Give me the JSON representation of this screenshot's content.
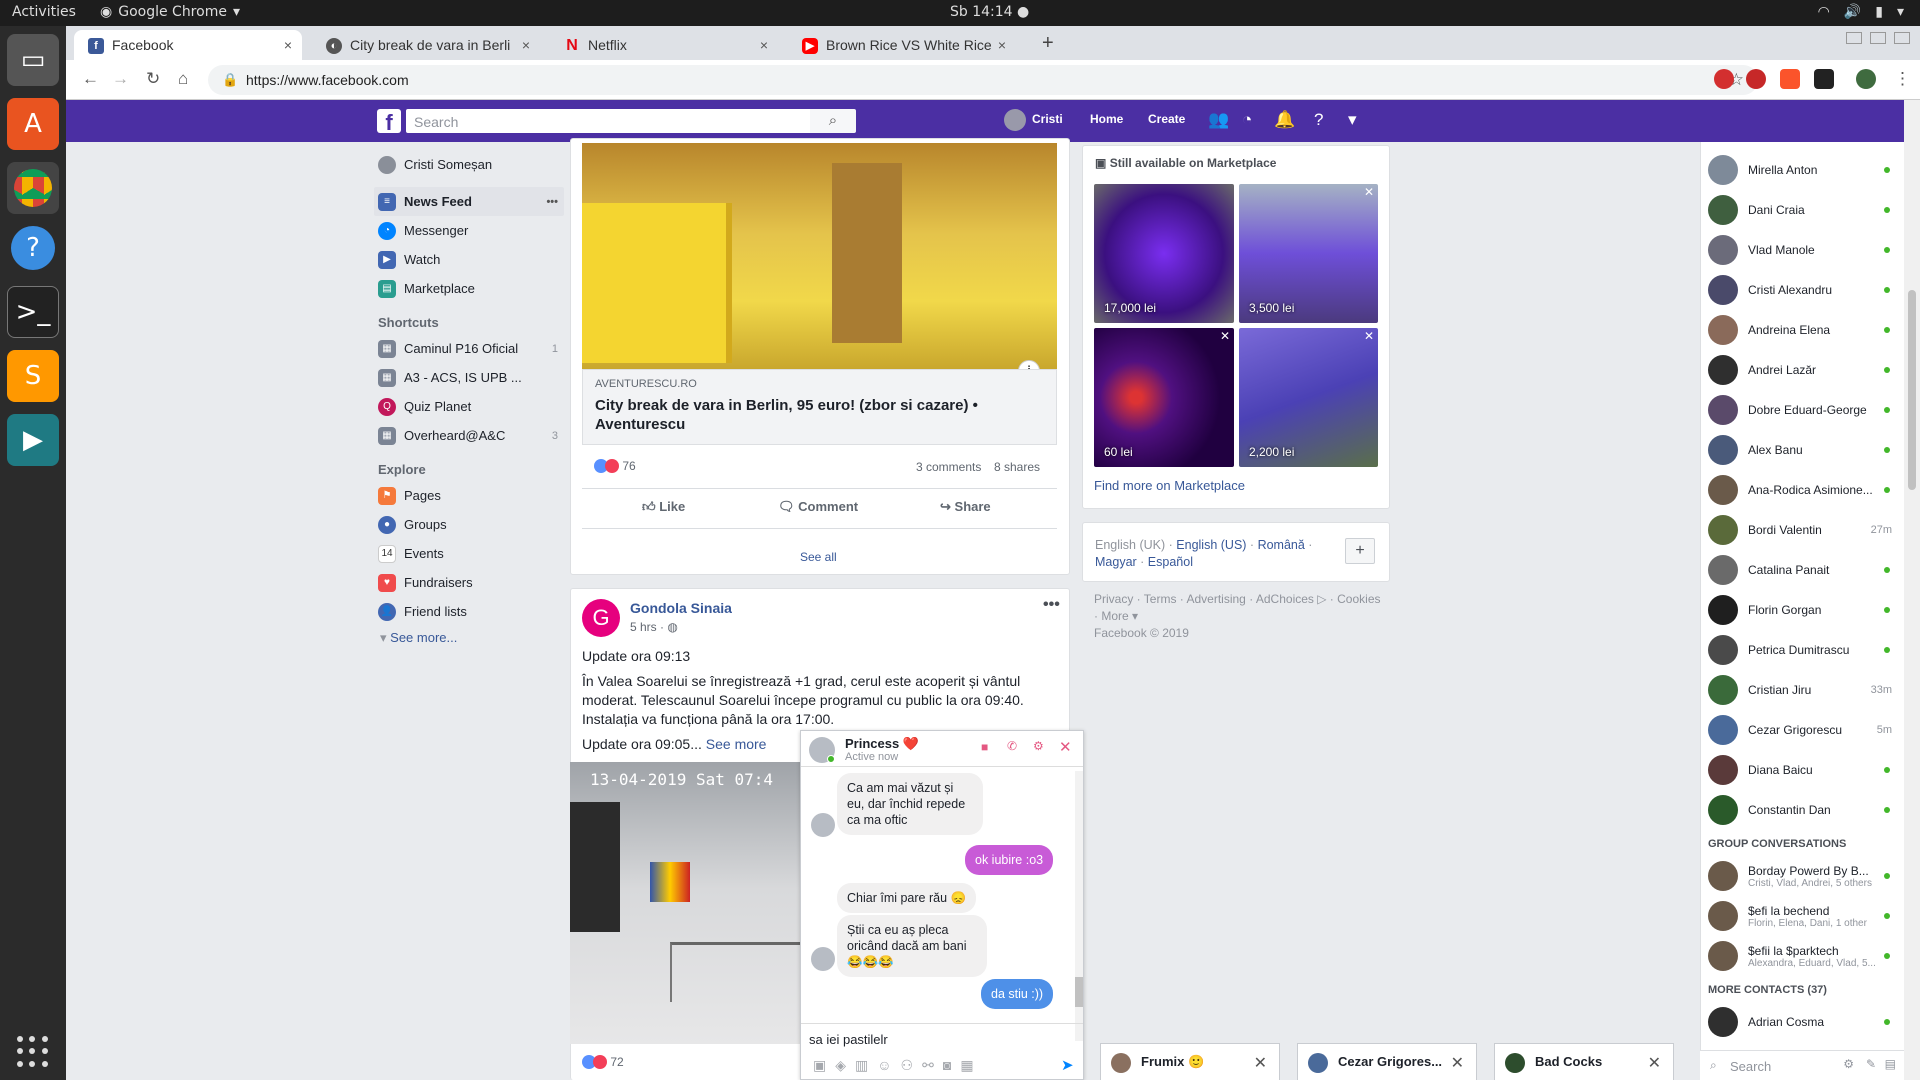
{
  "os": {
    "activities": "Activities",
    "app_name": "Google Chrome",
    "clock": "Sb 14:14 ●"
  },
  "browser": {
    "tabs": [
      {
        "title": "Facebook",
        "icon": "facebook-icon",
        "color": "#3b5998"
      },
      {
        "title": "City break de vara in Berli",
        "icon": "globe-icon",
        "color": "#555555"
      },
      {
        "title": "Netflix",
        "icon": "netflix-icon",
        "color": "#e50914"
      },
      {
        "title": "Brown Rice VS White Rice",
        "icon": "youtube-icon",
        "color": "#ff0000"
      }
    ],
    "url": "https://www.facebook.com"
  },
  "fb": {
    "brand_color": "#4b2fa3",
    "search_placeholder": "Search",
    "user_name": "Cristi",
    "nav_home": "Home",
    "nav_create": "Create"
  },
  "left_nav": {
    "profile": "Cristi Someșan",
    "main": [
      {
        "label": "News Feed",
        "color": "#4267b2"
      },
      {
        "label": "Messenger",
        "color": "#0084ff"
      },
      {
        "label": "Watch",
        "color": "#4267b2"
      },
      {
        "label": "Marketplace",
        "color": "#2a9d8f"
      }
    ],
    "shortcuts_title": "Shortcuts",
    "shortcuts": [
      {
        "label": "Caminul P16 Oficial",
        "count": "1"
      },
      {
        "label": "A3 - ACS, IS UPB ...",
        "count": ""
      },
      {
        "label": "Quiz Planet",
        "count": ""
      },
      {
        "label": "Overheard@A&C",
        "count": "3"
      }
    ],
    "explore_title": "Explore",
    "explore": [
      {
        "label": "Pages",
        "color": "#f5793b"
      },
      {
        "label": "Groups",
        "color": "#4267b2"
      },
      {
        "label": "Events",
        "color": "#e9ebee"
      },
      {
        "label": "Fundraisers",
        "color": "#f04b4c"
      },
      {
        "label": "Friend lists",
        "color": "#4267b2"
      }
    ],
    "see_more": "See more..."
  },
  "post1": {
    "domain": "AVENTURESCU.RO",
    "title": "City break de vara in Berlin, 95 euro! (zbor si cazare) • Aventurescu",
    "reactions": "76",
    "comments": "3 comments",
    "shares": "8 shares",
    "like": "Like",
    "comment": "Comment",
    "share": "Share",
    "see_all": "See all"
  },
  "post2": {
    "page": "Gondola Sinaia",
    "time": "5 hrs · ",
    "line1": "Update ora 09:13",
    "body": "În Valea Soarelui se înregistrează +1 grad, cerul este acoperit și vântul moderat. Telescaunul Soarelui începe programul cu public la ora 09:40. Instalația va funcționa până la ora 17:00.",
    "line2": "Update ora 09:05... ",
    "see_more": "See more",
    "cam_stamp": "13-04-2019 Sat 07:4",
    "reactions": "72"
  },
  "marketplace": {
    "title": "Still available on Marketplace",
    "items": [
      {
        "price": "17,000 lei"
      },
      {
        "price": "3,500 lei"
      },
      {
        "price": "60 lei"
      },
      {
        "price": "2,200 lei"
      }
    ],
    "find_more": "Find more on Marketplace"
  },
  "languages": {
    "current": "English (UK)",
    "others": [
      "English (US)",
      "Română",
      "Magyar",
      "Español"
    ]
  },
  "footer": {
    "links": [
      "Privacy",
      "Terms",
      "Advertising",
      "AdChoices",
      "Cookies",
      "More"
    ],
    "copyright": "Facebook © 2019"
  },
  "contacts": [
    {
      "name": "Mirella Anton",
      "time": ""
    },
    {
      "name": "Dani Craia",
      "time": ""
    },
    {
      "name": "Vlad Manole",
      "time": ""
    },
    {
      "name": "Cristi Alexandru",
      "time": ""
    },
    {
      "name": "Andreina Elena",
      "time": ""
    },
    {
      "name": "Andrei Lazăr",
      "time": ""
    },
    {
      "name": "Dobre Eduard-George",
      "time": ""
    },
    {
      "name": "Alex Banu",
      "time": ""
    },
    {
      "name": "Ana-Rodica Asimione...",
      "time": ""
    },
    {
      "name": "Bordi Valentin",
      "time": "27m"
    },
    {
      "name": "Catalina Panait",
      "time": ""
    },
    {
      "name": "Florin Gorgan",
      "time": ""
    },
    {
      "name": "Petrica Dumitrascu",
      "time": ""
    },
    {
      "name": "Cristian Jiru",
      "time": "33m"
    },
    {
      "name": "Cezar Grigorescu",
      "time": "5m"
    },
    {
      "name": "Diana Baicu",
      "time": ""
    },
    {
      "name": "Constantin Dan",
      "time": ""
    }
  ],
  "group_title": "GROUP CONVERSATIONS",
  "groups": [
    {
      "name": "Borday Powerd By B...",
      "sub": "Cristi, Vlad, Andrei, 5 others"
    },
    {
      "name": "$efi la bechend",
      "sub": "Florin, Elena, Dani, 1 other"
    },
    {
      "name": "$efii la $parktech",
      "sub": "Alexandra, Eduard, Vlad, 5..."
    }
  ],
  "more_contacts_title": "MORE CONTACTS (37)",
  "more_contacts": [
    {
      "name": "Adrian Cosma"
    }
  ],
  "sidebar_search": "Search",
  "chat": {
    "name": "Princess ❤️",
    "status": "Active now",
    "messages": [
      "Ca am mai văzut și eu, dar închid repede ca ma oftic",
      "ok iubire :o3",
      "Chiar îmi pare rău 😞",
      "Știi ca eu aș pleca oricând dacă am bani 😂😂😂",
      "da stiu :))"
    ],
    "input_value": "sa iei pastilelr"
  },
  "minichats": [
    {
      "name": "Frumix 🙂"
    },
    {
      "name": "Cezar Grigores..."
    },
    {
      "name": "Bad Cocks"
    }
  ]
}
